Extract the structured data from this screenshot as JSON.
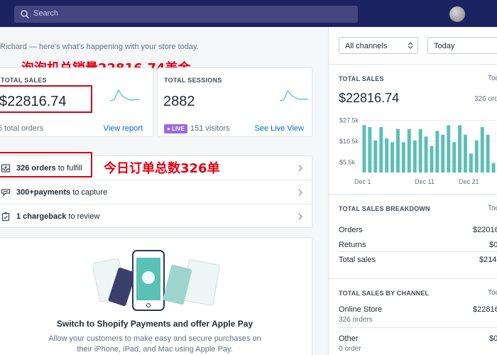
{
  "topbar": {
    "search_placeholder": "Search"
  },
  "greeting": "Richard — here's what's happening with your store today.",
  "sales_card": {
    "label": "TOTAL SALES",
    "value": "$22816.74",
    "orders": "5 total orders",
    "link": "View report",
    "spark": [
      0.2,
      0.3,
      0.95,
      0.5,
      0.35,
      0.25,
      0.3,
      0.28
    ]
  },
  "sessions_card": {
    "label": "TOTAL SESSIONS",
    "value": "2882",
    "live_badge": "LIVE",
    "visitors": "151 visitors",
    "link": "See Live View",
    "spark": [
      0.2,
      0.28,
      0.9,
      0.55,
      0.4,
      0.3,
      0.33,
      0.3
    ]
  },
  "annotations": {
    "sales_note": "泡泡机总销量22816.74美金",
    "orders_note": "今日订单总数326单"
  },
  "tasks": [
    {
      "bold": "326 orders",
      "rest": " to fulfill",
      "icon": "inbox-icon"
    },
    {
      "bold": "300+payments",
      "rest": " to capture",
      "icon": "payment-icon"
    },
    {
      "bold": "1 chargeback",
      "rest": " to review",
      "icon": "clipboard-icon"
    }
  ],
  "promo": {
    "title": "Switch to Shopify Payments and offer Apple Pay",
    "text": "Allow your customers to make easy and secure purchases on their iPhone, iPad, and Mac using Apple Pay."
  },
  "filters": {
    "channel": "All channels",
    "date": "Today"
  },
  "right_sales": {
    "title": "TOTAL SALES",
    "title_right": "Tod",
    "value": "$22816.74",
    "orders": "326 ord"
  },
  "chart_data": {
    "type": "bar",
    "ytick_labels": [
      "$27.5k",
      "$16.5k",
      "$5.5k"
    ],
    "ytick_values": [
      27.5,
      16.5,
      5.5
    ],
    "ylim": [
      0,
      30
    ],
    "xtick_labels": [
      "Dec 1",
      "Dec 11",
      "Dec 21"
    ],
    "values": [
      25,
      24,
      17,
      24,
      18,
      16,
      23,
      16,
      23,
      17,
      23,
      19,
      14,
      22,
      20,
      25,
      16,
      25,
      20,
      10,
      17,
      24,
      20,
      5
    ],
    "color": "#5bbfb5"
  },
  "breakdown": {
    "title": "TOTAL SALES BREAKDOWN",
    "title_right": "Tod",
    "rows": [
      {
        "label": "Orders",
        "value": "$22016"
      },
      {
        "label": "Returns",
        "value": "$0"
      },
      {
        "label": "Total sales",
        "value": "$214"
      }
    ]
  },
  "by_channel": {
    "title": "TOTAL SALES BY CHANNEL",
    "title_right": "Tod",
    "rows": [
      {
        "label": "Online Store",
        "sub": "326 orders",
        "value": "$22816"
      },
      {
        "label": "Other",
        "sub": "0 order",
        "value": "$0"
      }
    ]
  }
}
